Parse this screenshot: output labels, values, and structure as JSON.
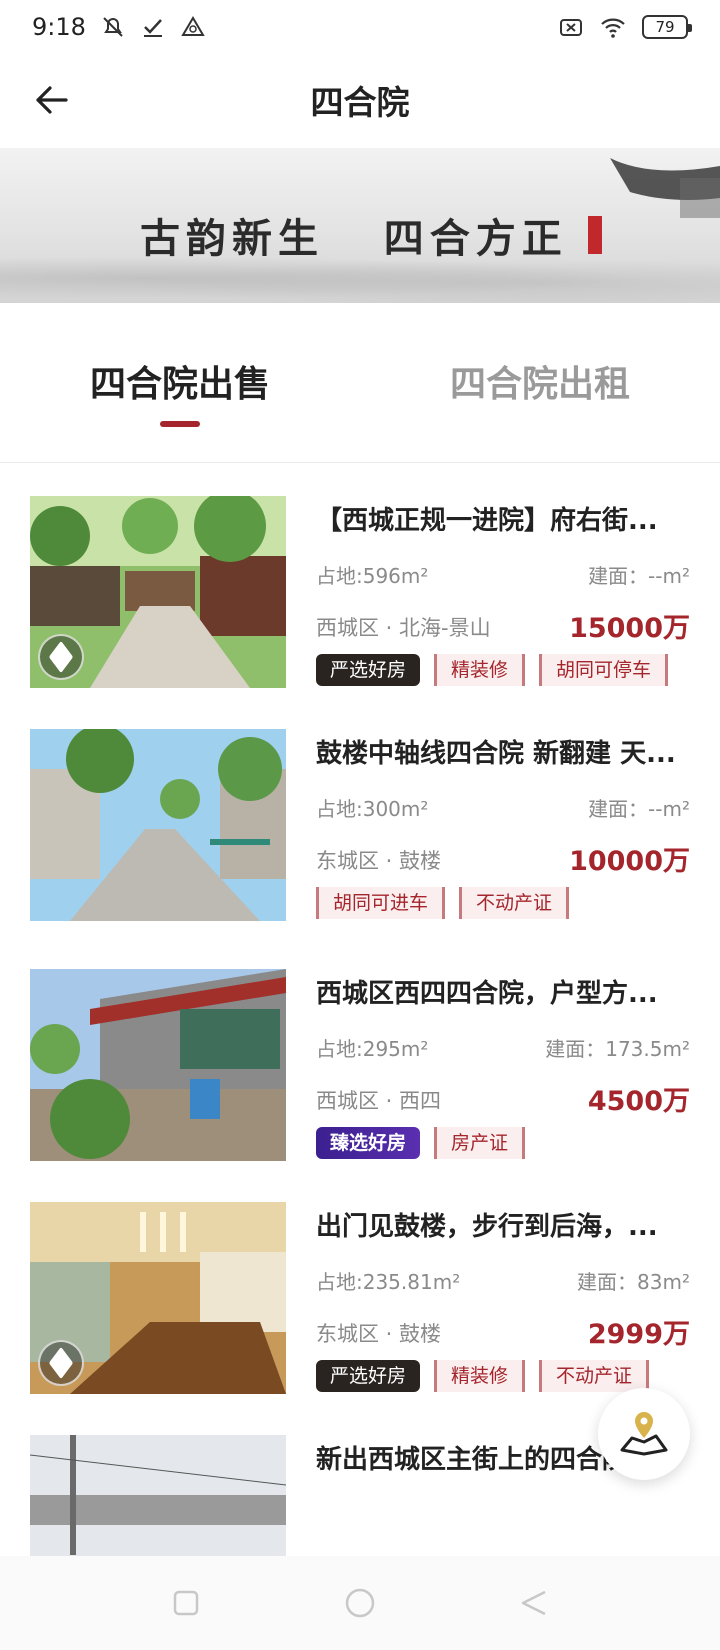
{
  "status_bar": {
    "time": "9:18",
    "battery": "79"
  },
  "header": {
    "title": "四合院",
    "back_label": "back"
  },
  "banner": {
    "text": "古韵新生   四合方正"
  },
  "tabs": [
    {
      "label": "四合院出售",
      "active": true
    },
    {
      "label": "四合院出租",
      "active": false
    }
  ],
  "listings": [
    {
      "title": "【西城正规一进院】府右街...",
      "area": "占地:596m²",
      "built": "建面：--m²",
      "location": "西城区 · 北海-景山",
      "price": "15000万",
      "has_vr": true,
      "tags": [
        "严选好房",
        "精装修",
        "胡同可停车"
      ]
    },
    {
      "title": "鼓楼中轴线四合院 新翻建 天...",
      "area": "占地:300m²",
      "built": "建面：--m²",
      "location": "东城区 · 鼓楼",
      "price": "10000万",
      "has_vr": false,
      "tags": [
        "胡同可进车",
        "不动产证"
      ]
    },
    {
      "title": "西城区西四四合院，户型方...",
      "area": "占地:295m²",
      "built": "建面：173.5m²",
      "location": "西城区 · 西四",
      "price": "4500万",
      "has_vr": false,
      "tags": [
        "臻选好房",
        "房产证"
      ]
    },
    {
      "title": "出门见鼓楼，步行到后海，...",
      "area": "占地:235.81m²",
      "built": "建面：83m²",
      "location": "东城区 · 鼓楼",
      "price": "2999万",
      "has_vr": true,
      "tags": [
        "严选好房",
        "精装修",
        "不动产证"
      ]
    },
    {
      "title": "新出西城区主街上的四合院...",
      "area": "",
      "built": "",
      "location": "",
      "price": "",
      "has_vr": false,
      "tags": []
    }
  ],
  "colors": {
    "accent": "#a4262c",
    "tag_bg": "#fbeeee",
    "strict_tag": "#2a2420",
    "premium_tag": "#3b1f8f"
  },
  "icons": [
    "back-arrow-icon",
    "mute-icon",
    "check-icon",
    "triangle-icon",
    "sim-icon",
    "wifi-icon",
    "battery-icon",
    "vr-cube-icon",
    "map-pin-icon"
  ]
}
